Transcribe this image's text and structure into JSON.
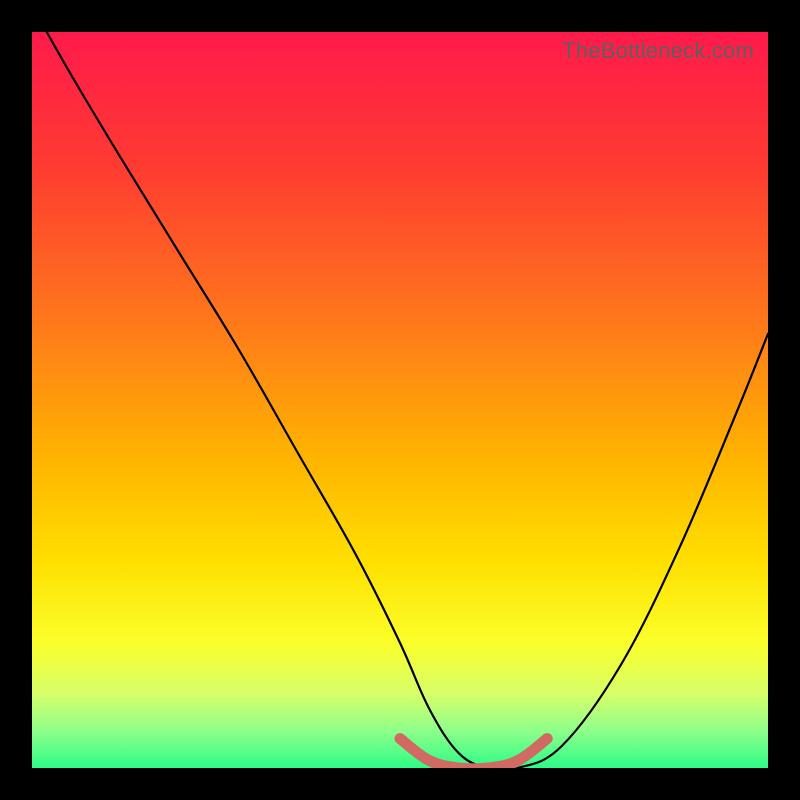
{
  "watermark": "TheBottleneck.com",
  "colors": {
    "frame": "#000000",
    "curve": "#000000",
    "highlight": "#d16a63",
    "gradient_stops": [
      {
        "offset": 0.0,
        "color": "#ff1a4b"
      },
      {
        "offset": 0.18,
        "color": "#ff3a32"
      },
      {
        "offset": 0.4,
        "color": "#ff7a1a"
      },
      {
        "offset": 0.58,
        "color": "#ffb400"
      },
      {
        "offset": 0.72,
        "color": "#ffe000"
      },
      {
        "offset": 0.83,
        "color": "#fbff2a"
      },
      {
        "offset": 0.9,
        "color": "#d6ff6a"
      },
      {
        "offset": 0.95,
        "color": "#8dff8a"
      },
      {
        "offset": 1.0,
        "color": "#2dfc86"
      }
    ]
  },
  "chart_data": {
    "type": "line",
    "title": "",
    "xlabel": "",
    "ylabel": "",
    "xlim": [
      0,
      100
    ],
    "ylim": [
      0,
      100
    ],
    "series": [
      {
        "name": "bottleneck-curve",
        "x": [
          2,
          6,
          12,
          20,
          28,
          36,
          44,
          50,
          54,
          58,
          62,
          66,
          72,
          80,
          88,
          96,
          100
        ],
        "y": [
          100,
          93,
          83,
          70,
          57,
          43,
          29,
          17,
          8,
          2,
          0,
          0,
          3,
          14,
          30,
          49,
          59
        ]
      }
    ],
    "highlight": {
      "x": [
        50,
        54,
        58,
        62,
        66,
        70
      ],
      "y": [
        4,
        1,
        0,
        0,
        1,
        4
      ]
    }
  }
}
